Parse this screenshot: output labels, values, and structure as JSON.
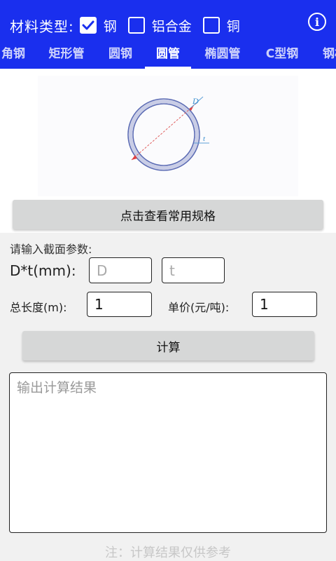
{
  "header": {
    "material_title": "材料类型:",
    "options": [
      {
        "label": "钢",
        "checked": true
      },
      {
        "label": "铝合金",
        "checked": false
      },
      {
        "label": "铜",
        "checked": false
      }
    ],
    "info_glyph": "i",
    "color": "#1a2fee"
  },
  "tabs": [
    {
      "label": "角钢"
    },
    {
      "label": "矩形管"
    },
    {
      "label": "圆钢"
    },
    {
      "label": "圆管",
      "active": true
    },
    {
      "label": "椭圆管"
    },
    {
      "label": "C型钢"
    },
    {
      "label": "钢板"
    }
  ],
  "diagram": {
    "label_d": "D",
    "label_t": "t"
  },
  "buttons": {
    "spec": "点击查看常用规格",
    "calc": "计算"
  },
  "form": {
    "prompt": "请输入截面参数:",
    "dt_label": "D*t(mm):",
    "d_placeholder": "D",
    "t_placeholder": "t",
    "length_label": "总长度(m):",
    "length_value": "1",
    "price_label": "单价(元/吨):",
    "price_value": "1"
  },
  "output": {
    "placeholder": "输出计算结果"
  },
  "note": "注：计算结果仅供参考"
}
